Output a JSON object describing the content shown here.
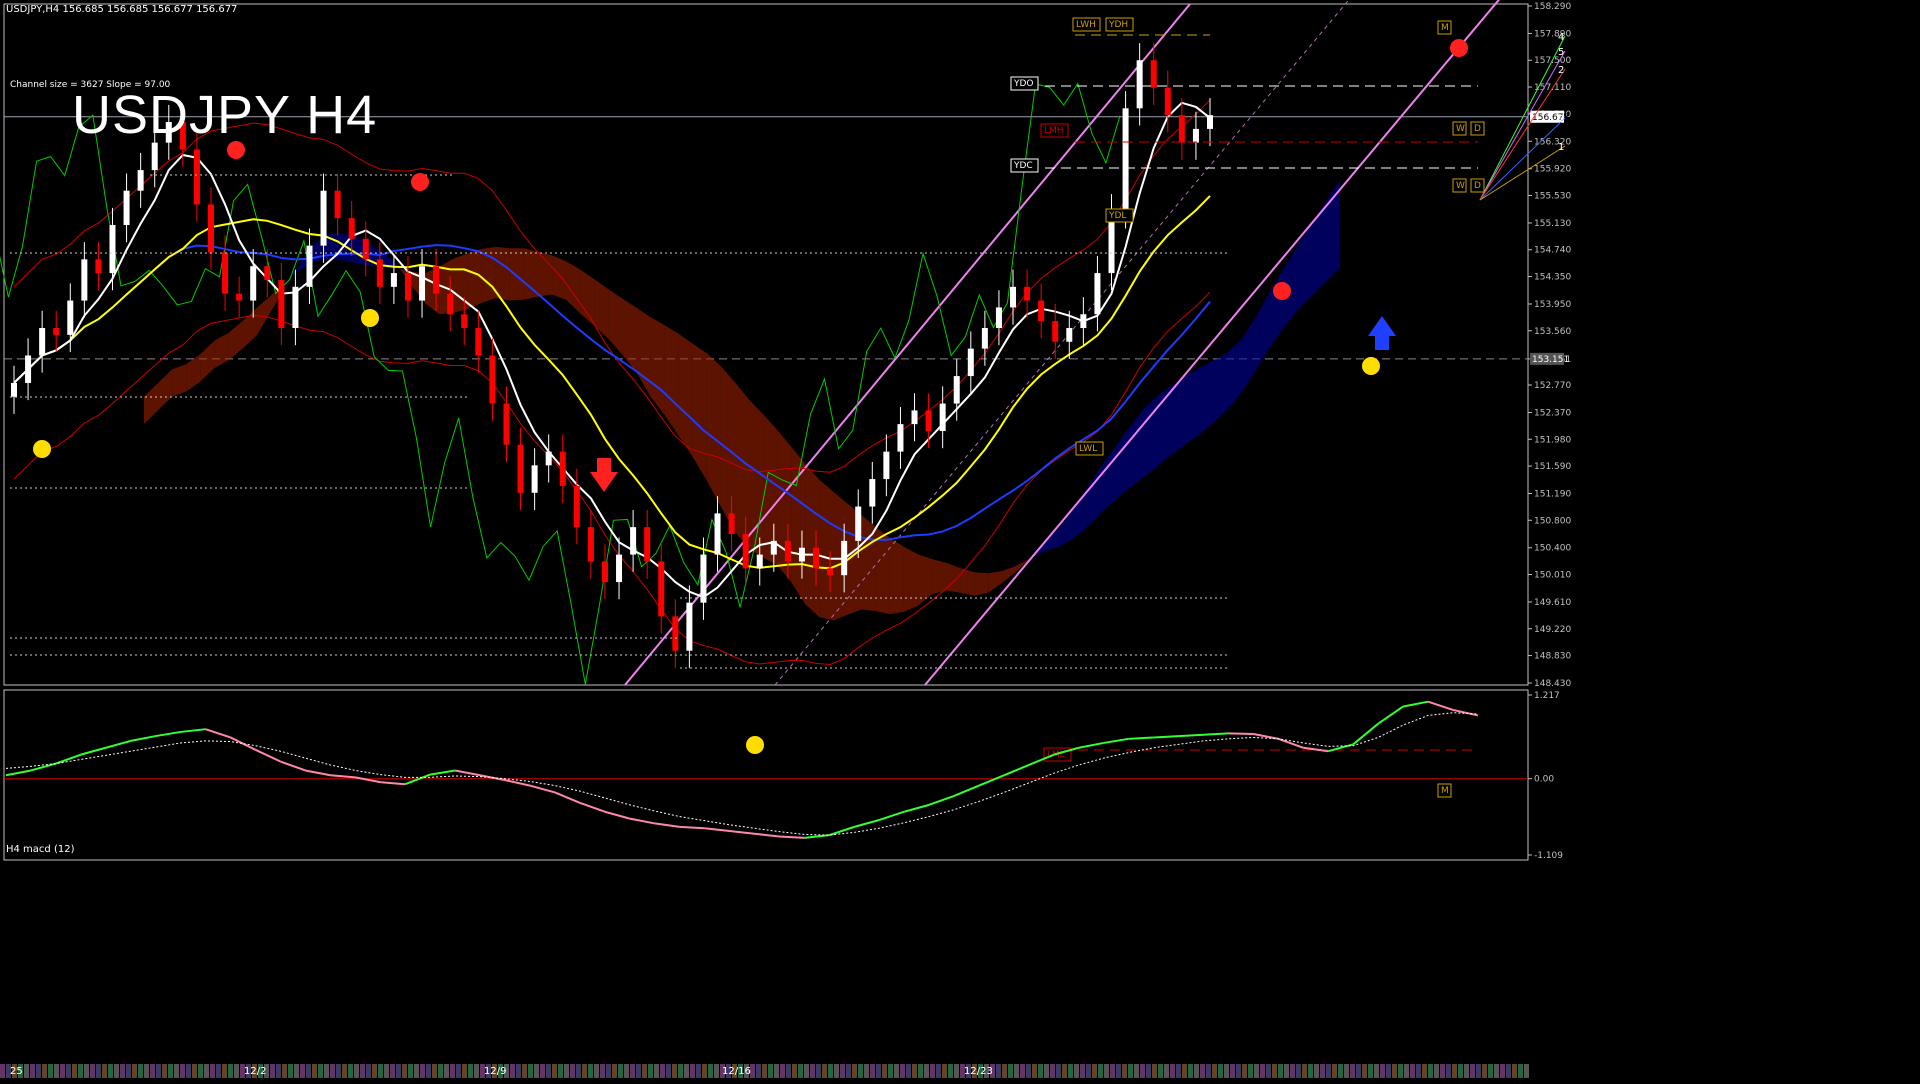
{
  "header": {
    "instrument_line": "USDJPY,H4  156.685 156.685 156.677 156.677",
    "channel_info": "Channel size = 3627 Slope = 97.00",
    "big_title": "USDJPY H4",
    "sub_window_label": "H4  macd (12)"
  },
  "colors": {
    "background": "#000000",
    "axis": "#c0c0c0",
    "bull_candle": "#ffffff",
    "bear_candle": "#ff0000",
    "channel": "#ee82ee",
    "ema_white": "#ffffff",
    "ema_yellow": "#ffff00",
    "ema_blue": "#1e3cff",
    "chikou": "#00cc00",
    "bollinger": "#cc0000",
    "cloud_up": "#0000aa",
    "cloud_down": "#aa2200",
    "macd_up": "#33ff33",
    "macd_down": "#ff88aa",
    "macd_signal": "#ffffff"
  },
  "chart_data": [
    {
      "type": "candlestick",
      "title": "USDJPY H4",
      "price_axis": {
        "ticks": [
          "158.290",
          "157.890",
          "157.500",
          "157.110",
          "156.720",
          "156.320",
          "155.920",
          "155.530",
          "155.130",
          "154.740",
          "154.350",
          "153.950",
          "153.560",
          "153.151",
          "152.770",
          "152.370",
          "151.980",
          "151.590",
          "151.190",
          "150.800",
          "150.400",
          "150.010",
          "149.610",
          "149.220",
          "148.830",
          "148.430"
        ],
        "current_price": "156.677",
        "marked_level": "153.151",
        "ylim": [
          148.43,
          158.29
        ]
      },
      "date_labels": [
        "25",
        "12/2",
        "12/9",
        "12/16",
        "12/23"
      ],
      "level_labels": [
        "LWH",
        "YDH",
        "YDO",
        "LMH",
        "YDC",
        "YDL",
        "LWL",
        "LML",
        "W",
        "D",
        "M"
      ],
      "channel_projection_labels": [
        "4",
        "5",
        "2",
        "3",
        "1"
      ],
      "close_series": [
        152.8,
        153.2,
        153.6,
        153.5,
        154.0,
        154.6,
        154.4,
        155.1,
        155.6,
        155.9,
        156.3,
        156.6,
        156.2,
        155.4,
        154.7,
        154.1,
        154.0,
        154.5,
        154.3,
        153.6,
        154.2,
        154.8,
        155.6,
        155.2,
        154.9,
        154.6,
        154.2,
        154.4,
        154.0,
        154.5,
        154.1,
        153.8,
        153.6,
        153.2,
        152.5,
        151.9,
        151.2,
        151.6,
        151.8,
        151.3,
        150.7,
        150.2,
        149.9,
        150.3,
        150.7,
        150.2,
        149.4,
        148.9,
        149.6,
        150.3,
        150.9,
        150.6,
        150.1,
        150.3,
        150.5,
        150.2,
        150.4,
        150.1,
        150.0,
        150.5,
        151.0,
        151.4,
        151.8,
        152.2,
        152.4,
        152.1,
        152.5,
        152.9,
        153.3,
        153.6,
        153.9,
        154.2,
        154.0,
        153.7,
        153.4,
        153.6,
        153.8,
        154.4,
        155.3,
        156.8,
        157.5,
        157.1,
        156.7,
        156.3,
        156.5,
        156.7
      ],
      "macd_axis": {
        "ticks": [
          "1.217",
          "0.00",
          "-1.109"
        ],
        "ylim": [
          -1.109,
          1.217
        ]
      },
      "macd_series": [
        0.05,
        0.12,
        0.22,
        0.35,
        0.45,
        0.55,
        0.62,
        0.68,
        0.72,
        0.6,
        0.42,
        0.25,
        0.12,
        0.05,
        0.02,
        -0.05,
        -0.08,
        0.06,
        0.12,
        0.05,
        -0.02,
        -0.1,
        -0.2,
        -0.35,
        -0.48,
        -0.58,
        -0.65,
        -0.7,
        -0.72,
        -0.76,
        -0.8,
        -0.84,
        -0.86,
        -0.82,
        -0.7,
        -0.6,
        -0.48,
        -0.38,
        -0.25,
        -0.1,
        0.05,
        0.2,
        0.35,
        0.45,
        0.52,
        0.58,
        0.6,
        0.62,
        0.64,
        0.66,
        0.65,
        0.58,
        0.45,
        0.4,
        0.5,
        0.8,
        1.05,
        1.12,
        1.0,
        0.92
      ],
      "macd_signal": [
        0.15,
        0.18,
        0.22,
        0.28,
        0.34,
        0.4,
        0.46,
        0.52,
        0.55,
        0.54,
        0.48,
        0.4,
        0.3,
        0.2,
        0.12,
        0.06,
        0.02,
        0.02,
        0.04,
        0.03,
        0.0,
        -0.04,
        -0.1,
        -0.18,
        -0.28,
        -0.38,
        -0.47,
        -0.55,
        -0.61,
        -0.67,
        -0.72,
        -0.77,
        -0.81,
        -0.82,
        -0.78,
        -0.72,
        -0.64,
        -0.55,
        -0.45,
        -0.33,
        -0.2,
        -0.06,
        0.08,
        0.2,
        0.3,
        0.38,
        0.45,
        0.5,
        0.55,
        0.58,
        0.6,
        0.58,
        0.52,
        0.47,
        0.48,
        0.6,
        0.78,
        0.92,
        0.96,
        0.94
      ]
    }
  ]
}
